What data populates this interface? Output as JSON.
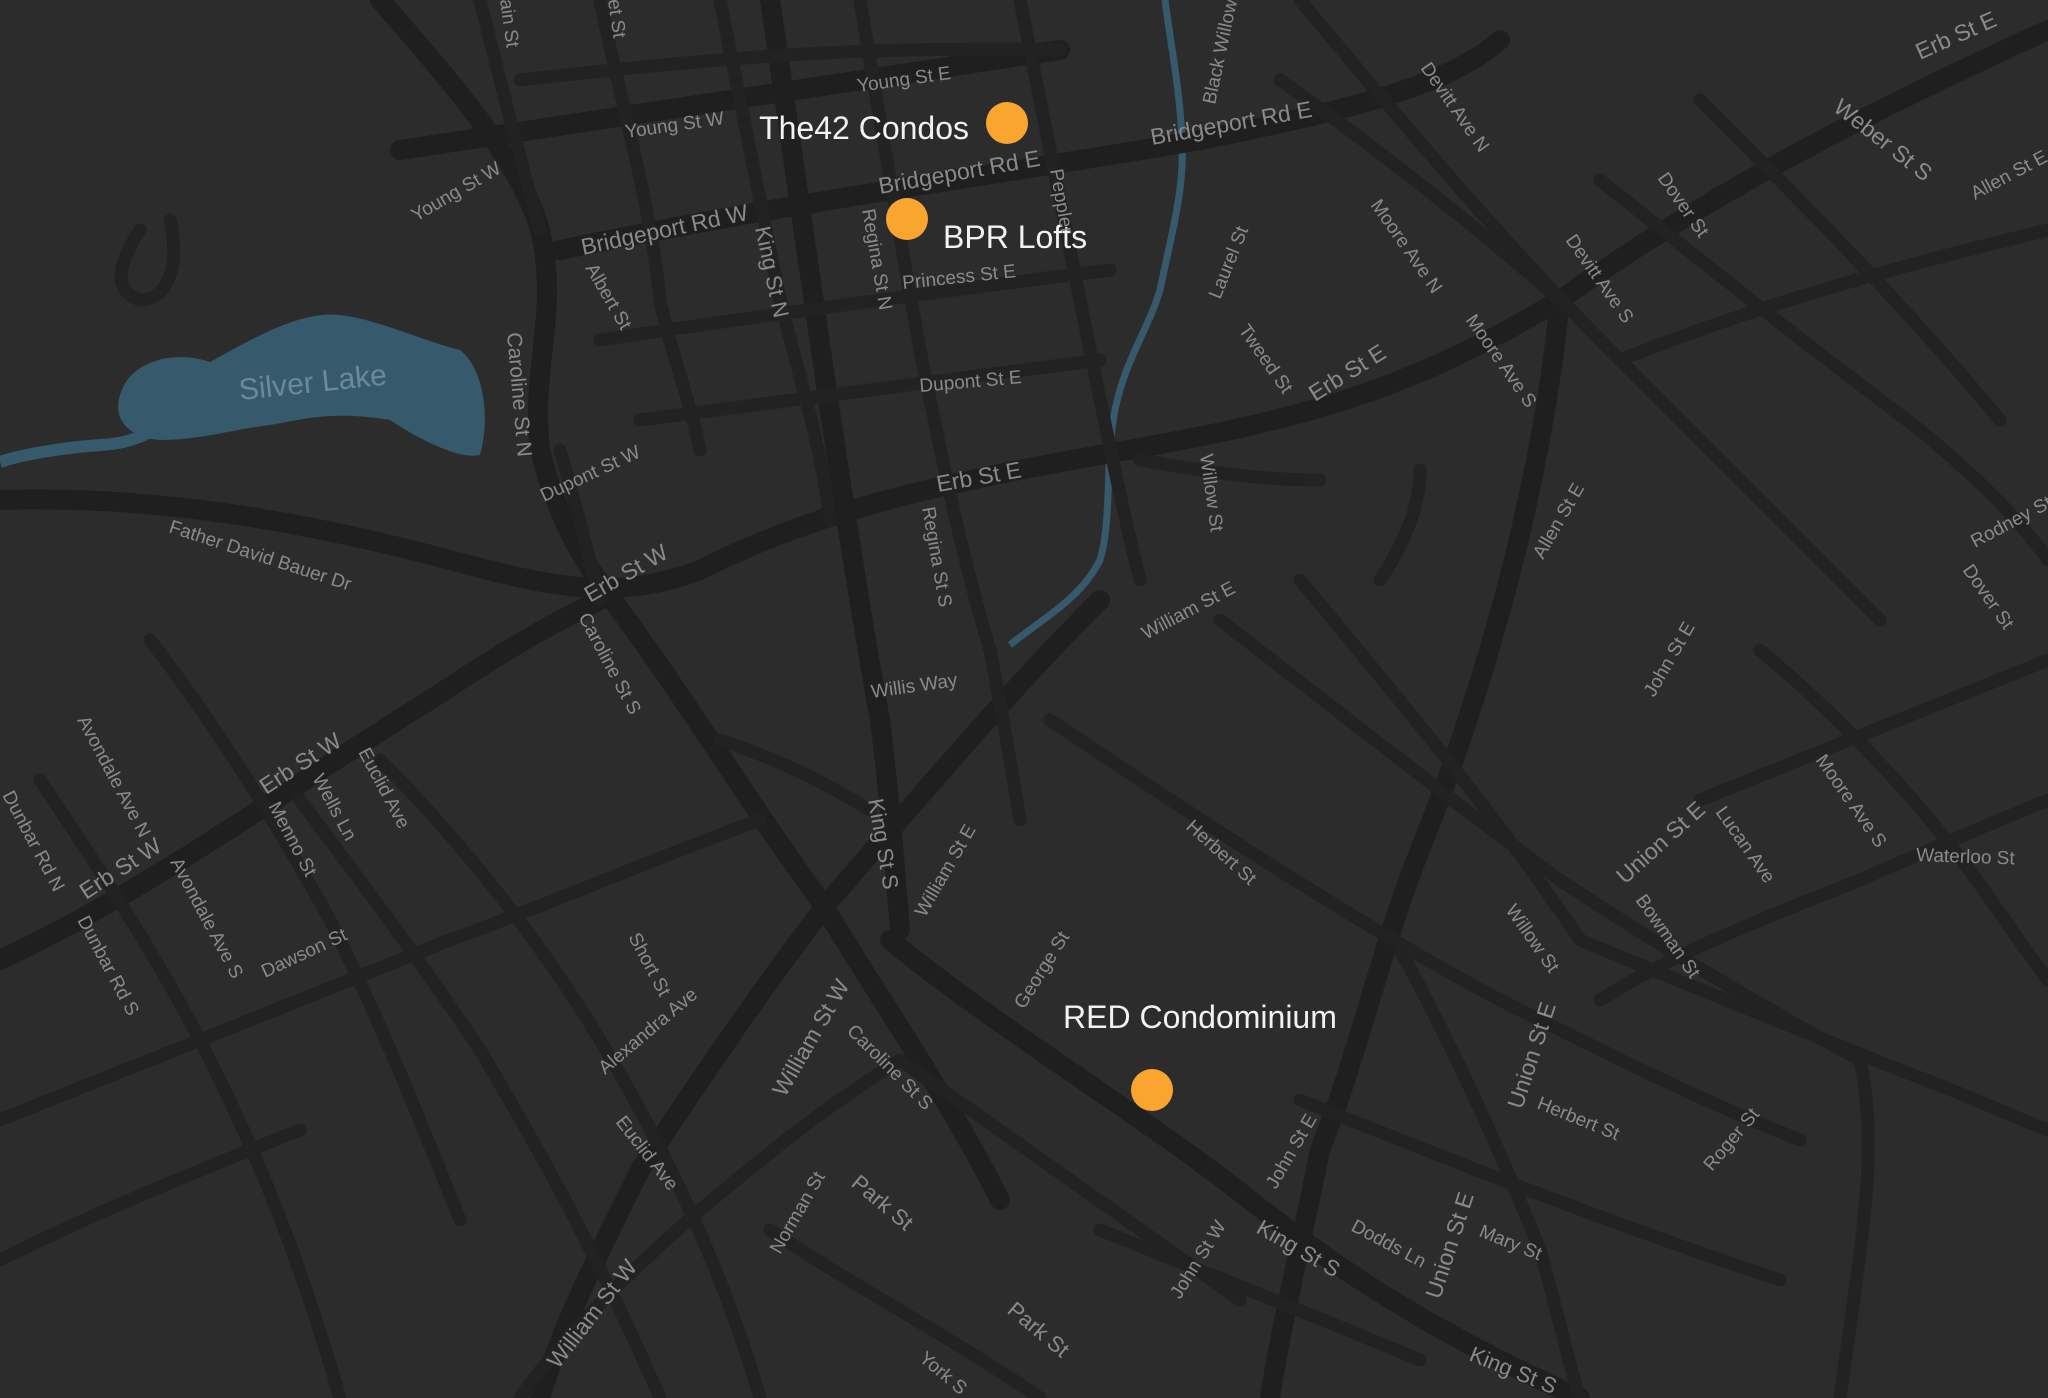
{
  "map": {
    "colors": {
      "background": "#2c2c2c",
      "road": "#1f1f1f",
      "water": "#36596b",
      "marker": "#f9a530",
      "label": "#f2f2f2",
      "street_label": "#8a8a8a"
    },
    "water_labels": {
      "silver_lake": "Silver Lake"
    },
    "markers": [
      {
        "name": "The42 Condos"
      },
      {
        "name": "BPR Lofts"
      },
      {
        "name": "RED Condominium"
      }
    ],
    "streets": {
      "young_e": "Young St E",
      "young_w": "Young St W",
      "young_w2": "Young St W",
      "bridgeport_e": "Bridgeport Rd E",
      "bridgeport_e2": "Bridgeport Rd E",
      "bridgeport_w": "Bridgeport Rd W",
      "princess_e": "Princess St E",
      "dupont_e": "Dupont St E",
      "dupont_w": "Dupont St W",
      "erb_e": "Erb St E",
      "erb_e2": "Erb St E",
      "erb_e3": "Erb St E",
      "erb_w": "Erb St W",
      "erb_w2": "Erb St W",
      "erb_w3": "Erb St W",
      "king_n": "King St N",
      "king_s": "King St S",
      "king_s2": "King St S",
      "king_s3": "King St S",
      "regina_n": "Regina St N",
      "regina_s": "Regina St S",
      "albert": "Albert St",
      "caroline_n": "Caroline St N",
      "caroline_s": "Caroline St S",
      "caroline_s2": "Caroline St S",
      "father_bauer": "Father David Bauer Dr",
      "willis": "Willis Way",
      "william_e": "William St E",
      "william_e2": "William St E",
      "william_w": "William St W",
      "william_w2": "William St W",
      "george": "George St",
      "herbert": "Herbert St",
      "herbert2": "Herbert St",
      "john_e": "John St E",
      "john_e2": "John St E",
      "john_w": "John St W",
      "union_e": "Union St E",
      "union_e2": "Union St E",
      "union_e3": "Union St E",
      "willow": "Willow St",
      "willow2": "Willow St",
      "laurel": "Laurel St",
      "tweed": "Tweed St",
      "moore_n": "Moore Ave N",
      "moore_s": "Moore Ave S",
      "moore_s2": "Moore Ave S",
      "devitt_n": "Devitt Ave N",
      "devitt_s": "Devitt Ave S",
      "dover": "Dover St",
      "dover2": "Dover St",
      "weber_s": "Weber St S",
      "allen_e": "Allen St E",
      "allen_e2": "Allen St E",
      "rodney": "Rodney St",
      "waterloo": "Waterloo St",
      "lucan": "Lucan Ave",
      "bowman": "Bowman St",
      "roger": "Roger St",
      "mary": "Mary St",
      "dodds": "Dodds Ln",
      "park": "Park St",
      "park2": "Park St",
      "norman": "Norman St",
      "euclid": "Euclid Ave",
      "euclid2": "Euclid Ave",
      "alexandra": "Alexandra Ave",
      "short": "Short St",
      "dawson": "Dawson St",
      "menno": "Menno St",
      "wells": "Wells Ln",
      "avondale_n": "Avondale Ave N",
      "avondale_s": "Avondale Ave S",
      "dunbar_n": "Dunbar Rd N",
      "dunbar_s": "Dunbar Rd S",
      "black_willow": "Black Willow Lin",
      "peppler": "Peppler",
      "main": "ain St",
      "st_partial": "et St",
      "york": "York S"
    }
  }
}
